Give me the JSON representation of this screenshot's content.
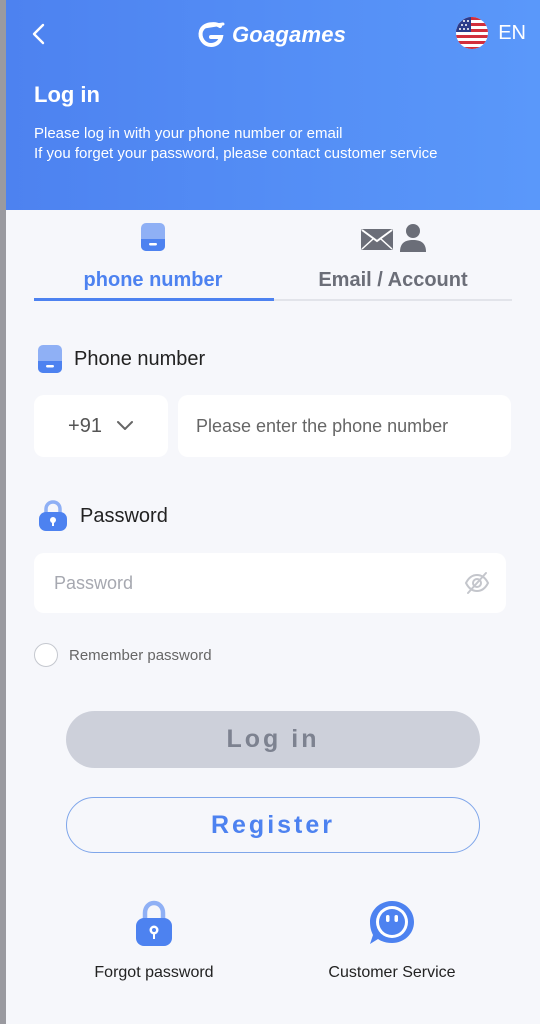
{
  "header": {
    "logo": "Goagames",
    "language": "EN",
    "title": "Log in",
    "line1": "Please log in with your phone number or email",
    "line2": "If you forget your password, please contact customer service"
  },
  "tabs": [
    {
      "label": "phone number",
      "active": true
    },
    {
      "label": "Email / Account",
      "active": false
    }
  ],
  "phone_field": {
    "label": "Phone number",
    "country_code": "+91",
    "placeholder": "Please enter the phone number"
  },
  "password_field": {
    "label": "Password",
    "placeholder": "Password"
  },
  "remember": {
    "label": "Remember password",
    "checked": false
  },
  "buttons": {
    "login": "Log in",
    "register": "Register"
  },
  "bottom": {
    "forgot": "Forgot password",
    "service": "Customer Service"
  },
  "colors": {
    "primary": "#4d82f0",
    "header_start": "#4d82f0",
    "header_end": "#5a98fa",
    "login_disabled": "#cdd0da"
  }
}
